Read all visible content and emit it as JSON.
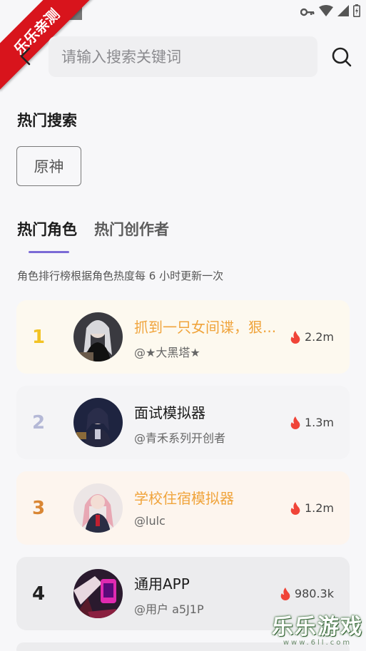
{
  "ribbon": {
    "label": "乐乐亲测"
  },
  "search": {
    "placeholder": "请输入搜索关键词"
  },
  "hot_search": {
    "title": "热门搜索",
    "chips": [
      "原神"
    ]
  },
  "tabs": [
    {
      "label": "热门角色",
      "active": true
    },
    {
      "label": "热门创作者",
      "active": false
    }
  ],
  "subtitle": "角色排行榜根据角色热度每 6 小时更新一次",
  "ranking": [
    {
      "rank": "1",
      "name": "抓到一只女间谍，狠...",
      "author": "@★大黑塔★",
      "heat": "2.2m"
    },
    {
      "rank": "2",
      "name": "面试模拟器",
      "author": "@青禾系列开创者",
      "heat": "1.3m"
    },
    {
      "rank": "3",
      "name": "学校住宿模拟器",
      "author": "@lulc",
      "heat": "1.2m"
    },
    {
      "rank": "4",
      "name": "通用APP",
      "author": "@用户 a5J1P",
      "heat": "980.3k"
    }
  ],
  "watermark": {
    "main": "乐乐游戏",
    "url": "www.6ll.com"
  },
  "colors": {
    "accent": "#7b6ad6",
    "rank1_bg": "#fdf9ef",
    "rank1_color": "#f2c324",
    "rank2_bg": "#f4f4f6",
    "rank2_color": "#b4b8d6",
    "rank3_bg": "#fdf5ee",
    "rank3_color": "#d98634",
    "rank4_bg": "#ececee",
    "rank4_color": "#222222",
    "highlight_name": "#f0a43c",
    "flame": "#f04438"
  }
}
